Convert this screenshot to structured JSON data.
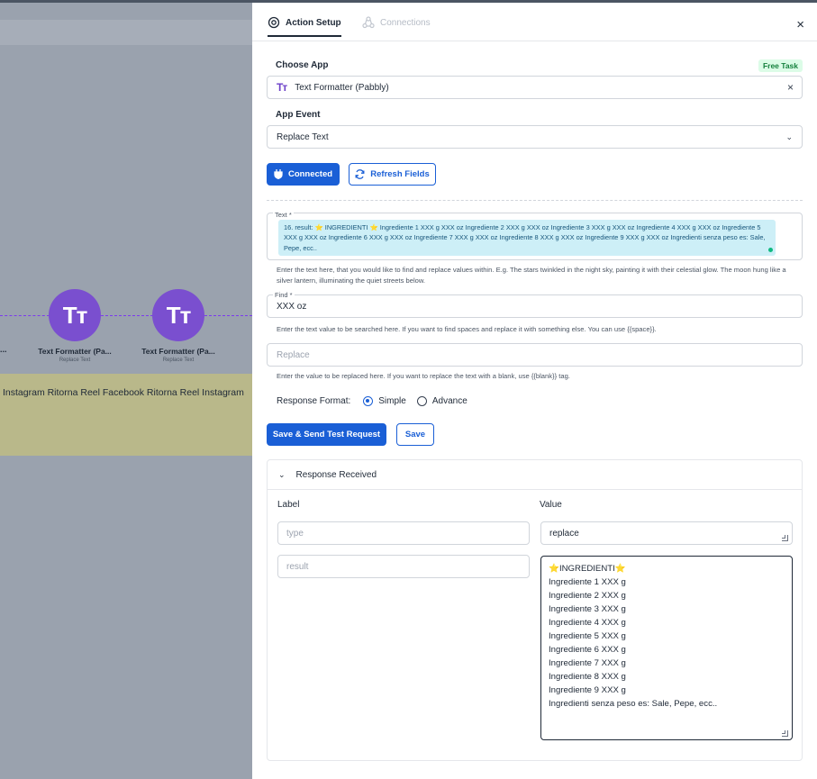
{
  "canvas": {
    "nodes": [
      {
        "title": "Text Formatter (Pa...",
        "sub": "Replace Text",
        "icon": "Tт"
      },
      {
        "title": "Text Formatter (Pa...",
        "sub": "Replace Text",
        "icon": "Tт"
      }
    ],
    "cut_label": "...",
    "strip_text": "Instagram Ritorna Reel Facebook Ritorna Reel Instagram"
  },
  "tabs": {
    "action_setup": "Action Setup",
    "connections": "Connections",
    "close": "×"
  },
  "choose_app": {
    "label": "Choose App",
    "badge": "Free Task",
    "icon": "Tт",
    "value": "Text Formatter (Pabbly)",
    "clear": "×"
  },
  "app_event": {
    "label": "App Event",
    "value": "Replace Text",
    "chevron": "⌄"
  },
  "buttons": {
    "connected": "Connected",
    "refresh": "Refresh Fields",
    "save_send": "Save & Send Test Request",
    "save": "Save"
  },
  "text_field": {
    "label": "Text *",
    "chip_prefix": "16. result: ",
    "chip_mid": " INGREDIENTI ",
    "chip_rest": " Ingrediente 1 XXX g XXX oz Ingrediente 2 XXX g XXX oz Ingrediente 3 XXX g XXX oz Ingrediente 4 XXX g XXX oz Ingrediente 5 XXX g XXX oz Ingrediente 6 XXX g XXX oz Ingrediente 7 XXX g XXX oz Ingrediente 8 XXX g XXX oz Ingrediente 9 XXX g XXX oz Ingredienti senza peso es: Sale, Pepe, ecc..",
    "help": "Enter the text here, that you would like to find and replace values within. E.g. The stars twinkled in the night sky, painting it with their celestial glow. The moon hung like a silver lantern, illuminating the quiet streets below."
  },
  "find_field": {
    "label": "Find *",
    "value": "XXX oz",
    "help": "Enter the text value to be searched here. If you want to find spaces and replace it with something else. You can use {{space}}."
  },
  "replace_field": {
    "placeholder": "Replace",
    "help": "Enter the value to be replaced here. If you want to replace the text with a blank, use {{blank}} tag."
  },
  "response_format": {
    "label": "Response Format:",
    "simple": "Simple",
    "advance": "Advance",
    "selected": "simple"
  },
  "response": {
    "title": "Response Received",
    "chevron": "⌄",
    "label_header": "Label",
    "value_header": "Value",
    "rows": [
      {
        "label": "type",
        "value": "replace"
      },
      {
        "label": "result"
      }
    ],
    "result_lines": [
      "INGREDIENTI",
      "Ingrediente 1 XXX g",
      "Ingrediente 2 XXX g",
      "Ingrediente 3 XXX g",
      "Ingrediente 4 XXX g",
      "Ingrediente 5 XXX g",
      "Ingrediente 6 XXX g",
      "Ingrediente 7 XXX g",
      "Ingrediente 8 XXX g",
      "Ingrediente 9 XXX g",
      "Ingredienti senza peso es: Sale, Pepe, ecc.."
    ],
    "star": "⭐"
  },
  "colors": {
    "primary": "#1a5fd6",
    "node": "#7a4fcf",
    "chip_bg": "#cdeff7",
    "badge_bg": "#dcfce7",
    "badge_fg": "#15803d"
  }
}
